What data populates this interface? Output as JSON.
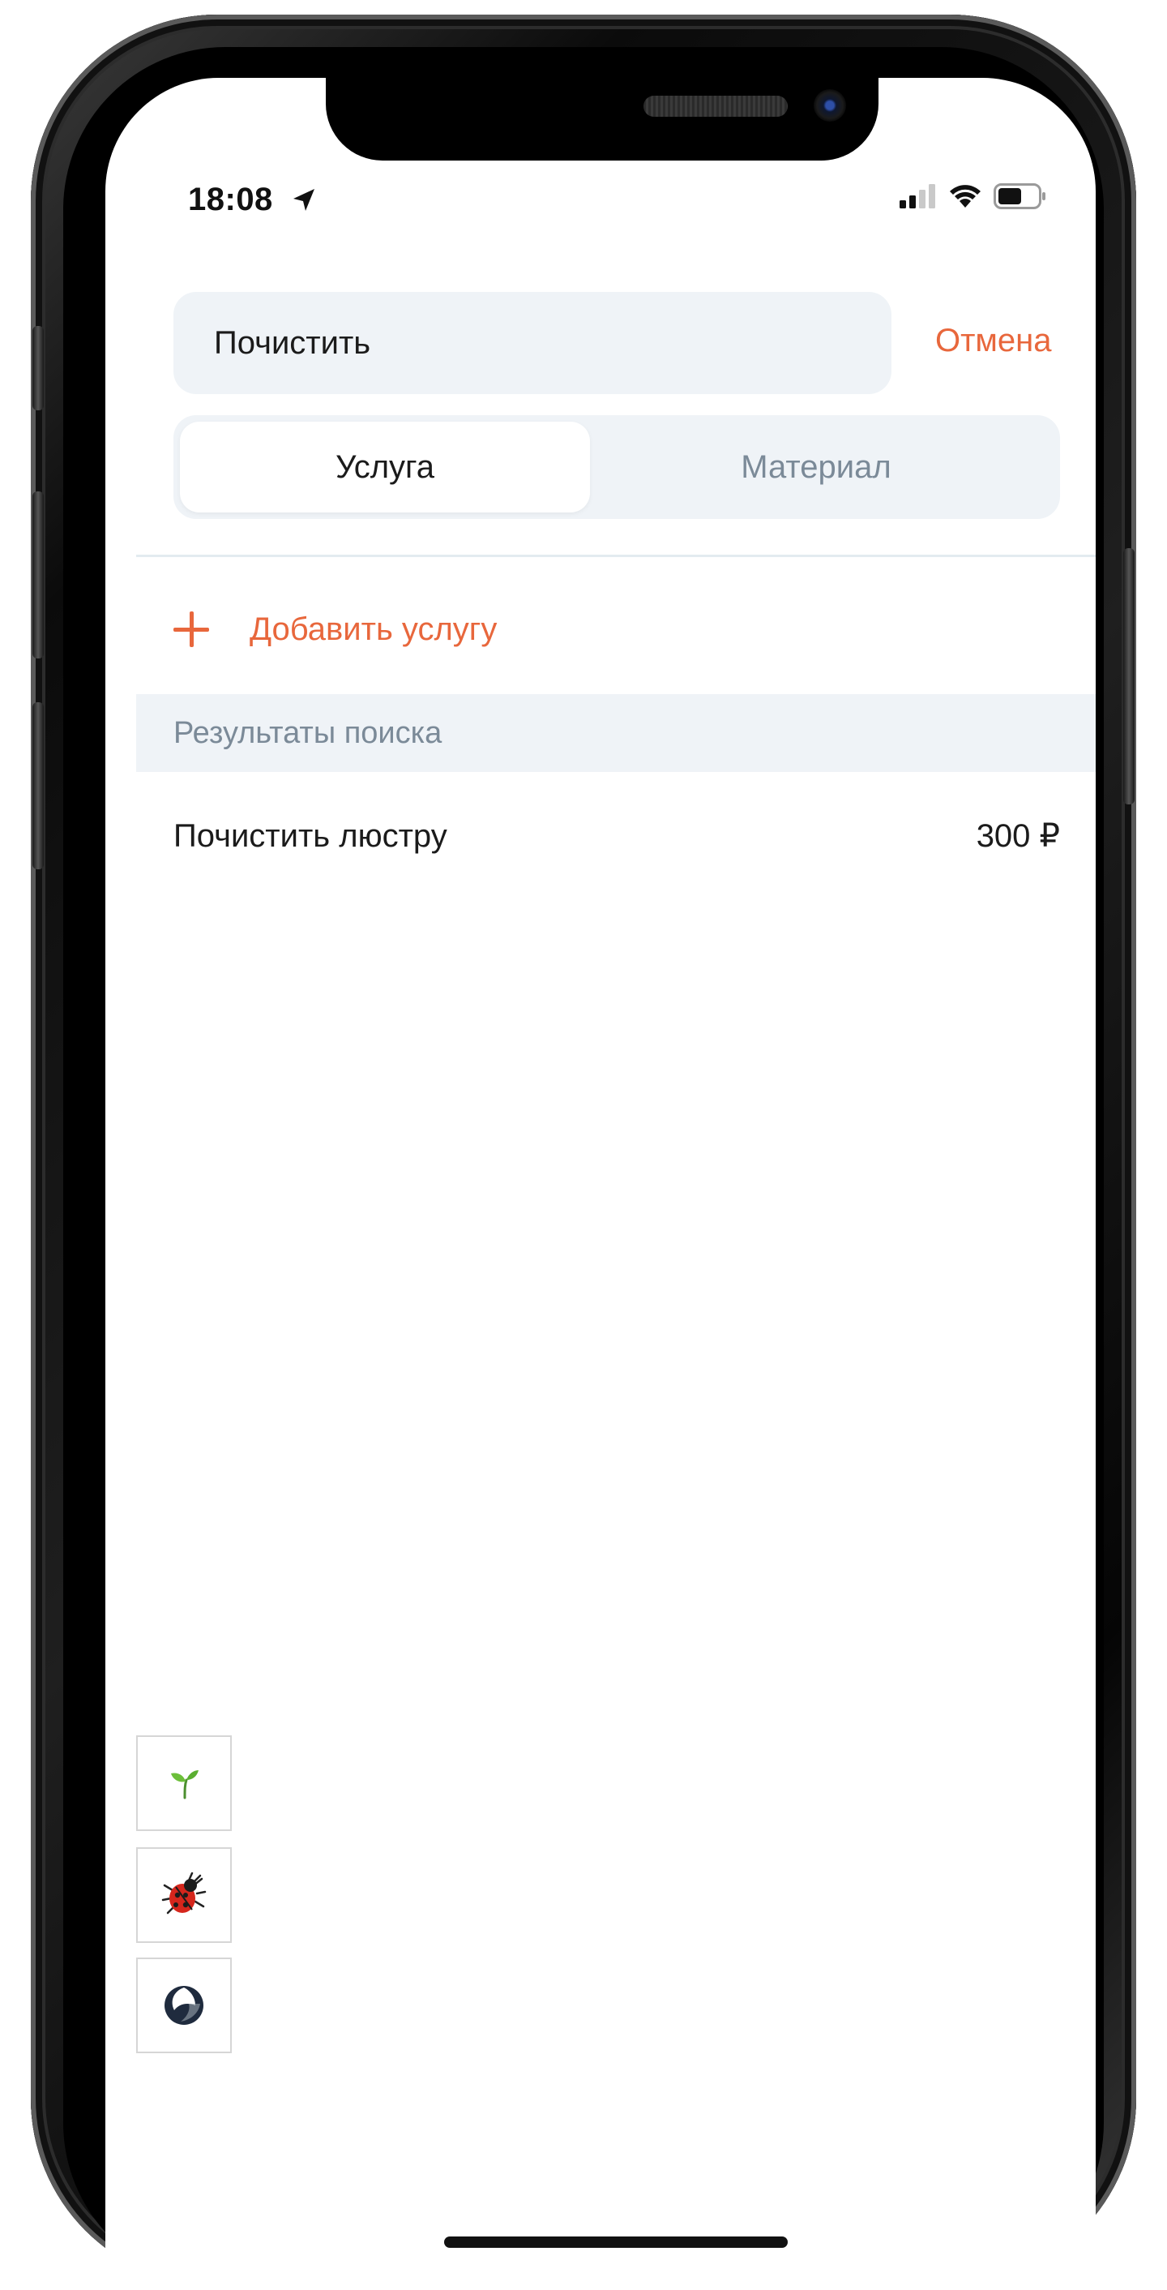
{
  "status_bar": {
    "time": "18:08"
  },
  "search": {
    "query": "Почистить",
    "cancel_label": "Отмена"
  },
  "tabs": [
    {
      "label": "Услуга",
      "selected": true
    },
    {
      "label": "Материал",
      "selected": false
    }
  ],
  "add_service": {
    "label": "Добавить услугу"
  },
  "results": {
    "header": "Результаты поиска",
    "items": [
      {
        "name": "Почистить люстру",
        "price": "300 ₽"
      }
    ]
  },
  "debug_tools": {
    "icons": [
      "sprout-icon",
      "ladybug-icon",
      "spinner-icon"
    ]
  },
  "colors": {
    "accent": "#e8673c",
    "field_background": "#eff3f7",
    "muted_text": "#7b8a98",
    "text": "#1b1b1b"
  }
}
